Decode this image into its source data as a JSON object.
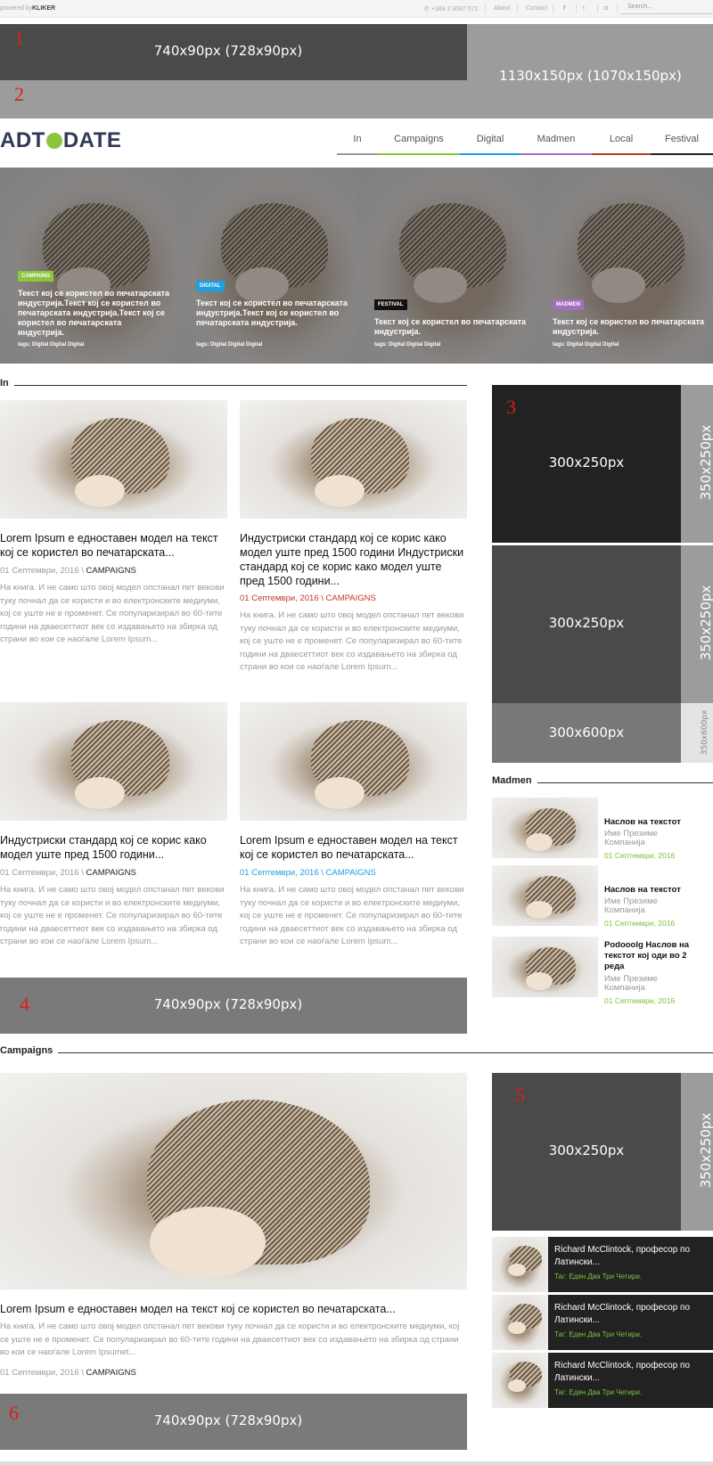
{
  "topbar": {
    "powered_by": "powered by",
    "brand": "KLIKER",
    "phone": "+389 2 3097 572",
    "about": "About",
    "contact": "Contact",
    "search_placeholder": "Search..."
  },
  "ads": {
    "ad1": {
      "label": "740x90px  (728x90px)",
      "num": "1"
    },
    "ad2": {
      "label": "1130x150px  (1070x150px)",
      "num": "2"
    },
    "ad3": {
      "label": "300x250px",
      "num": "3",
      "side": "350x250px"
    },
    "ad3b": {
      "label": "300x250px",
      "side": "350x250px"
    },
    "ad3c": {
      "label": "300x600px",
      "side": "350x600px"
    },
    "ad4": {
      "label": "740x90px  (728x90px)",
      "num": "4"
    },
    "ad5": {
      "label": "300x250px",
      "num": "5",
      "side": "350x250px"
    },
    "ad6": {
      "label": "740x90px  (728x90px)",
      "num": "6"
    }
  },
  "logo": {
    "left": "ADT",
    "right": "DATE"
  },
  "nav": [
    {
      "label": "In",
      "color": "#9e9e9e"
    },
    {
      "label": "Campaigns",
      "color": "#8cc63f"
    },
    {
      "label": "Digital",
      "color": "#1ba1e2"
    },
    {
      "label": "Madmen",
      "color": "#a46fbf"
    },
    {
      "label": "Local",
      "color": "#c0392b"
    },
    {
      "label": "Festival",
      "color": "#222222"
    }
  ],
  "hero": [
    {
      "badge": "CAMPAING",
      "badge_color": "#8cc63f",
      "text": "Текст кој се користел во печатарската индустрија.Текст кој се користел во печатарската индустрија.Текст кој се користел во печатарската индустрија.",
      "tags": "tags: Digital Digital Digital"
    },
    {
      "badge": "DIGITAL",
      "badge_color": "#1ba1e2",
      "text": "Текст кој се користел во печатарската индустрија.Текст кој се користел во печатарската индустрија.",
      "tags": "tags: Digital Digital Digital"
    },
    {
      "badge": "FESTIVAL",
      "badge_color": "#111111",
      "text": "Текст кој се користел во печатарската индустрија.",
      "tags": "tags: Digital Digital Digital"
    },
    {
      "badge": "MADMEN",
      "badge_color": "#a46fbf",
      "text": "Текст кој се користел во печатарската индустрија.",
      "tags": "tags: Digital Digital Digital"
    }
  ],
  "section_in": {
    "title": "In",
    "articles": [
      {
        "title": "Lorem Ipsum е едноставен модел на текст кој се користел во печатарската...",
        "date": "01 Септември, 2016 \\ ",
        "cat": "CAMPAIGNS",
        "date_color": "#999999",
        "excerpt": "На книга. И не само што овој модел опстанал пет векови тукy почнал да се користи и во електронските медиуми, кој се уште не е променет. Се популаризирал во 60-тите години на дваесеттиот век со издавањето на збирка од страни во кои се наоѓале Lorem Ipsum..."
      },
      {
        "title": "Индустриски стандард кој се корис како модел уште пред 1500 години Индустриски стандард кој се корис како модел уште пред 1500 години...",
        "date": "01 Септември, 2016 \\ CAMPAIGNS",
        "cat": "",
        "date_color": "#c0392b",
        "excerpt": "На книга. И не само што овој модел опстанал пет векови тукy почнал да се користи и во електронските медиуми, кој се уште не е променет. Се популаризирал во 60-тите години на дваесеттиот век со издавањето на збирка од страни во кои се наоѓале Lorem Ipsum..."
      },
      {
        "title": "Индустриски стандард кој се корис како модел уште пред 1500 години...",
        "date": "01 Септември, 2016 \\ ",
        "cat": "CAMPAIGNS",
        "date_color": "#999999",
        "excerpt": "На книга. И не само што овој модел опстанал пет векови тукy почнал да се користи и во електронските медиуми, кој се уште не е променет. Се популаризирал во 60-тите години на дваесеттиот век со издавањето на збирка од страни во кои се наоѓале Lorem Ipsum..."
      },
      {
        "title": "Lorem Ipsum е едноставен модел на текст кој се користел во печатарската...",
        "date": "01 Септември, 2016 \\ CAMPAIGNS",
        "cat": "",
        "date_color": "#1ba1e2",
        "excerpt": "На книга. И не само што овој модел опстанал пет векови тукy почнал да се користи и во електронските медиуми, кој се уште не е променет. Се популаризирал во 60-тите години на дваесеттиот век со издавањето на збирка од страни во кои се наоѓале Lorem Ipsum..."
      }
    ]
  },
  "madmen": {
    "title": "Madmen",
    "items": [
      {
        "title": "Наслов на текстот",
        "author": "Име Презиме Компанија",
        "date": "01 Септември, 2016"
      },
      {
        "title": "Наслов на текстот",
        "author": "Име Презиме Компанија",
        "date": "01 Септември, 2016"
      },
      {
        "title": "Podooolg Наслов на текстот кој оди во 2 реда",
        "author": "Име Презиме Компанија",
        "date": "01 Септември, 2016"
      }
    ]
  },
  "section_campaigns": {
    "title": "Campaigns",
    "headline": "Lorem Ipsum е едноставен модел на текст кој се користел во печатарската...",
    "excerpt": "На книга. И не само што овој модел опстанал пет векови тукy почнал да се користи и во електронските медиуми, кој се уште не е променет. Се популаризирал во 60-тите години на дваесеттиот век со издавањето на збирка од страни во кои се наоѓале Lorem Ipsumet...",
    "date": "01 Септември, 2016 \\ ",
    "cat": "CAMPAIGNS"
  },
  "dark_cards": [
    {
      "title": "Richard McClintock, професор по Латински...",
      "tags": "Таг: Еден Два Три Четири."
    },
    {
      "title": "Richard McClintock, професор по Латински...",
      "tags": "Таг: Еден Два Три Четири."
    },
    {
      "title": "Richard McClintock, професор по Латински...",
      "tags": "Таг: Еден Два Три Четири."
    }
  ]
}
